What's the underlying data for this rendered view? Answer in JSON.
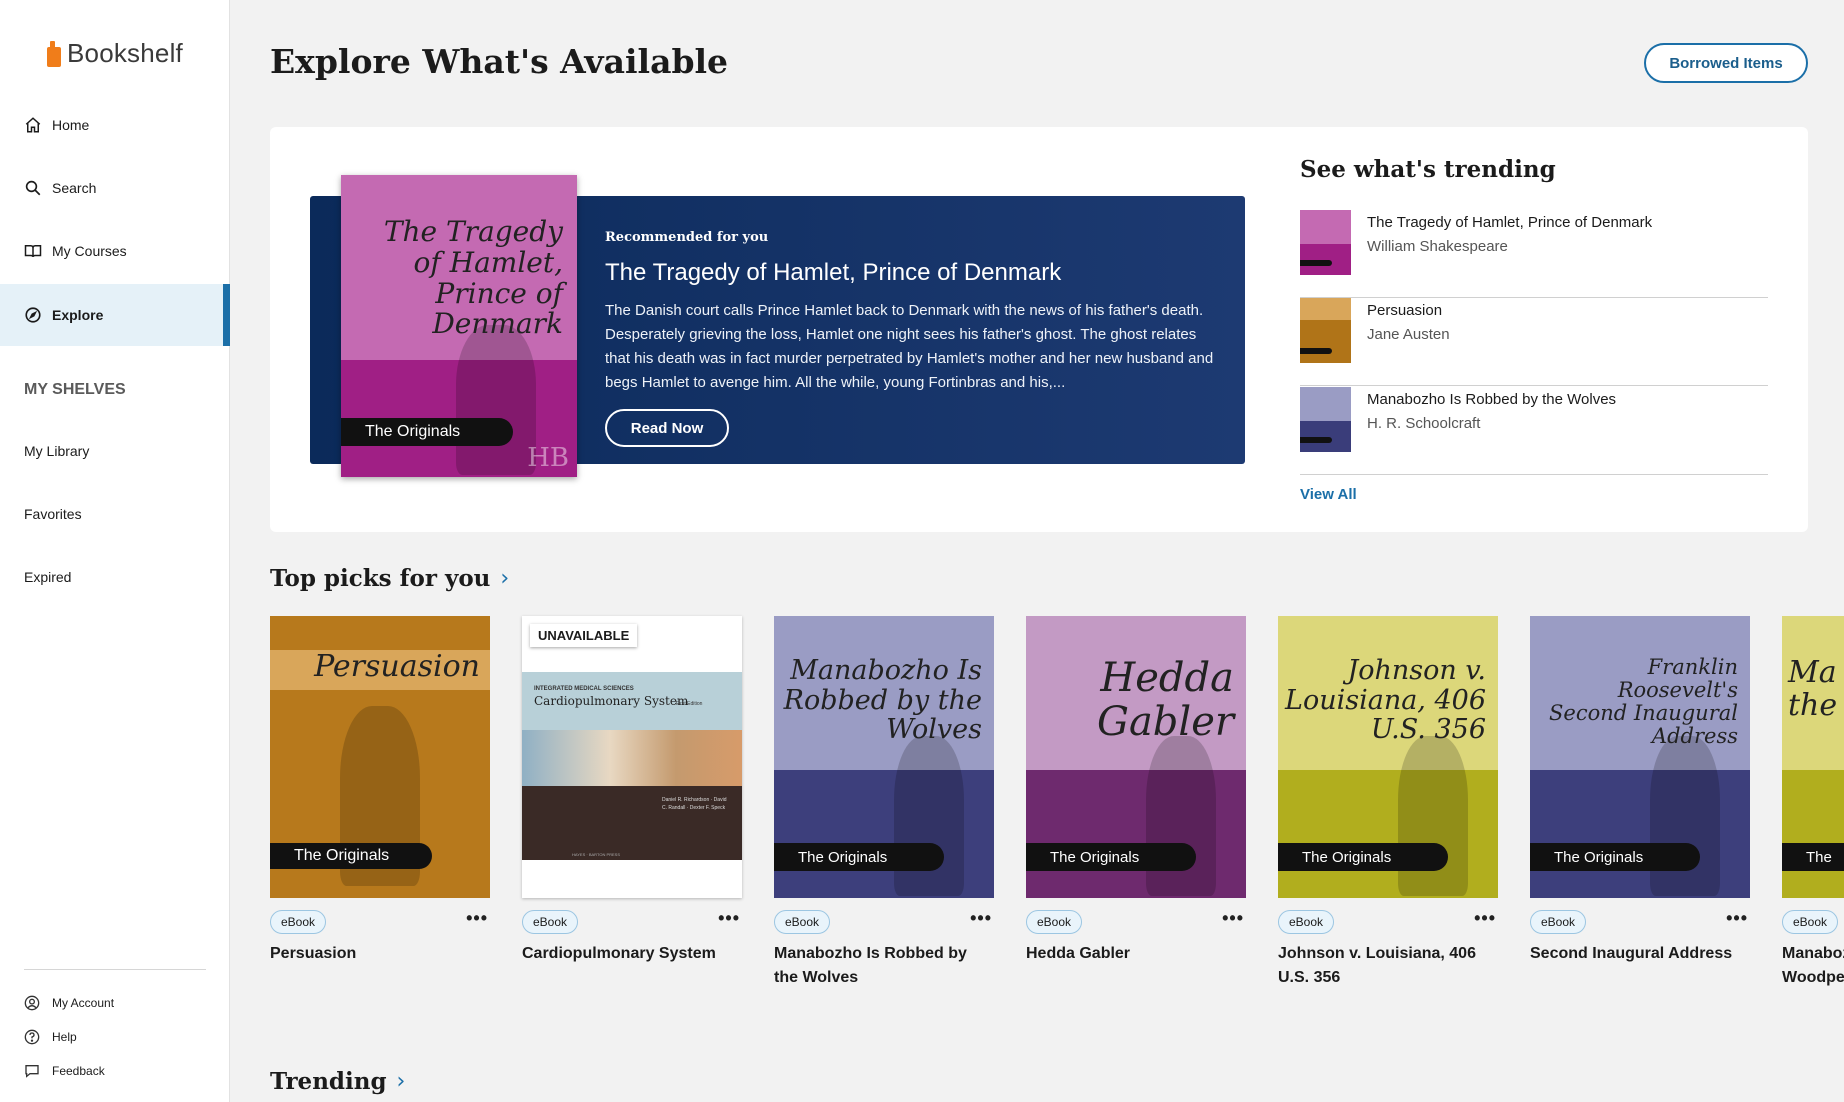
{
  "app": {
    "name": "Bookshelf"
  },
  "nav": {
    "home": "Home",
    "search": "Search",
    "courses": "My Courses",
    "explore": "Explore"
  },
  "shelves": {
    "heading": "MY SHELVES",
    "library": "My Library",
    "favorites": "Favorites",
    "expired": "Expired"
  },
  "footer": {
    "account": "My Account",
    "help": "Help",
    "feedback": "Feedback"
  },
  "page": {
    "title": "Explore What's Available",
    "borrowed_button": "Borrowed Items"
  },
  "hero": {
    "kicker": "Recommended for you",
    "title": "The Tragedy of Hamlet, Prince of Denmark",
    "description": "The Danish court calls Prince Hamlet back to Denmark with the news of his father's death. Desperately grieving the loss, Hamlet one night sees his father's ghost. The ghost relates that his death was in fact murder perpetrated by Hamlet's mother and her new husband and begs Hamlet to avenge him. All the while, young Fortinbras and his,...",
    "read_button": "Read Now",
    "cover_title": "The Tragedy of Hamlet, Prince of Denmark",
    "cover_series": "The Originals",
    "cover_mark": "HB"
  },
  "trending_panel": {
    "heading": "See what's trending",
    "items": [
      {
        "title": "The Tragedy of Hamlet, Prince of Denmark",
        "author": "William Shakespeare",
        "color": "#a01f85"
      },
      {
        "title": "Persuasion",
        "author": "Jane Austen",
        "color": "#b07418"
      },
      {
        "title": "Manabozho Is Robbed by the Wolves",
        "author": "H. R. Schoolcraft",
        "color": "#3a3d7a"
      }
    ],
    "view_all": "View All"
  },
  "top_picks": {
    "heading": "Top picks for you",
    "items": [
      {
        "title": "Persuasion",
        "format": "eBook",
        "cover_title": "Persuasion",
        "series": "The Originals",
        "color": "#b7791c",
        "band": "#d9a65a"
      },
      {
        "title": "Cardiopulmonary System",
        "format": "eBook",
        "unavailable": "UNAVAILABLE",
        "cover_kicker": "INTEGRATED MEDICAL SCIENCES",
        "cover_title": "Cardiopulmonary System",
        "cover_edition": "First Edition",
        "cover_authors": "Daniel R. Richardson · David C. Randall · Dexter F. Speck",
        "cover_publisher": "HAYES · BARTON PRESS"
      },
      {
        "title": "Manabozho Is Robbed by the Wolves",
        "format": "eBook",
        "cover_title": "Manabozho Is Robbed by the Wolves",
        "series": "The Originals",
        "color": "#3d3f7c",
        "band": "#9a9cc4"
      },
      {
        "title": "Hedda Gabler",
        "format": "eBook",
        "cover_title": "Hedda Gabler",
        "series": "The Originals",
        "color": "#6e2a6e",
        "band": "#c39ac4"
      },
      {
        "title": "Johnson v. Louisiana, 406 U.S. 356",
        "format": "eBook",
        "cover_title": "Johnson v. Louisiana, 406 U.S. 356",
        "series": "The Originals",
        "color": "#b1ae1e",
        "band": "#dcd77a"
      },
      {
        "title": "Second Inaugural Address",
        "format": "eBook",
        "cover_title": "Franklin Roosevelt's Second Inaugural Address",
        "series": "The Originals",
        "color": "#3d3f7c",
        "band": "#9a9cc4"
      },
      {
        "title": "Manabozho and his Woodpecker",
        "format": "eBook",
        "cover_title": "Ma the",
        "series": "The",
        "color": "#b1ae1e",
        "band": "#dcd77a"
      }
    ]
  },
  "trending_section": {
    "heading": "Trending"
  },
  "colors": {
    "accent": "#1b6fa8",
    "sidebar_active": "#e5f1f8",
    "hero_banner": "#0b2a5a"
  }
}
